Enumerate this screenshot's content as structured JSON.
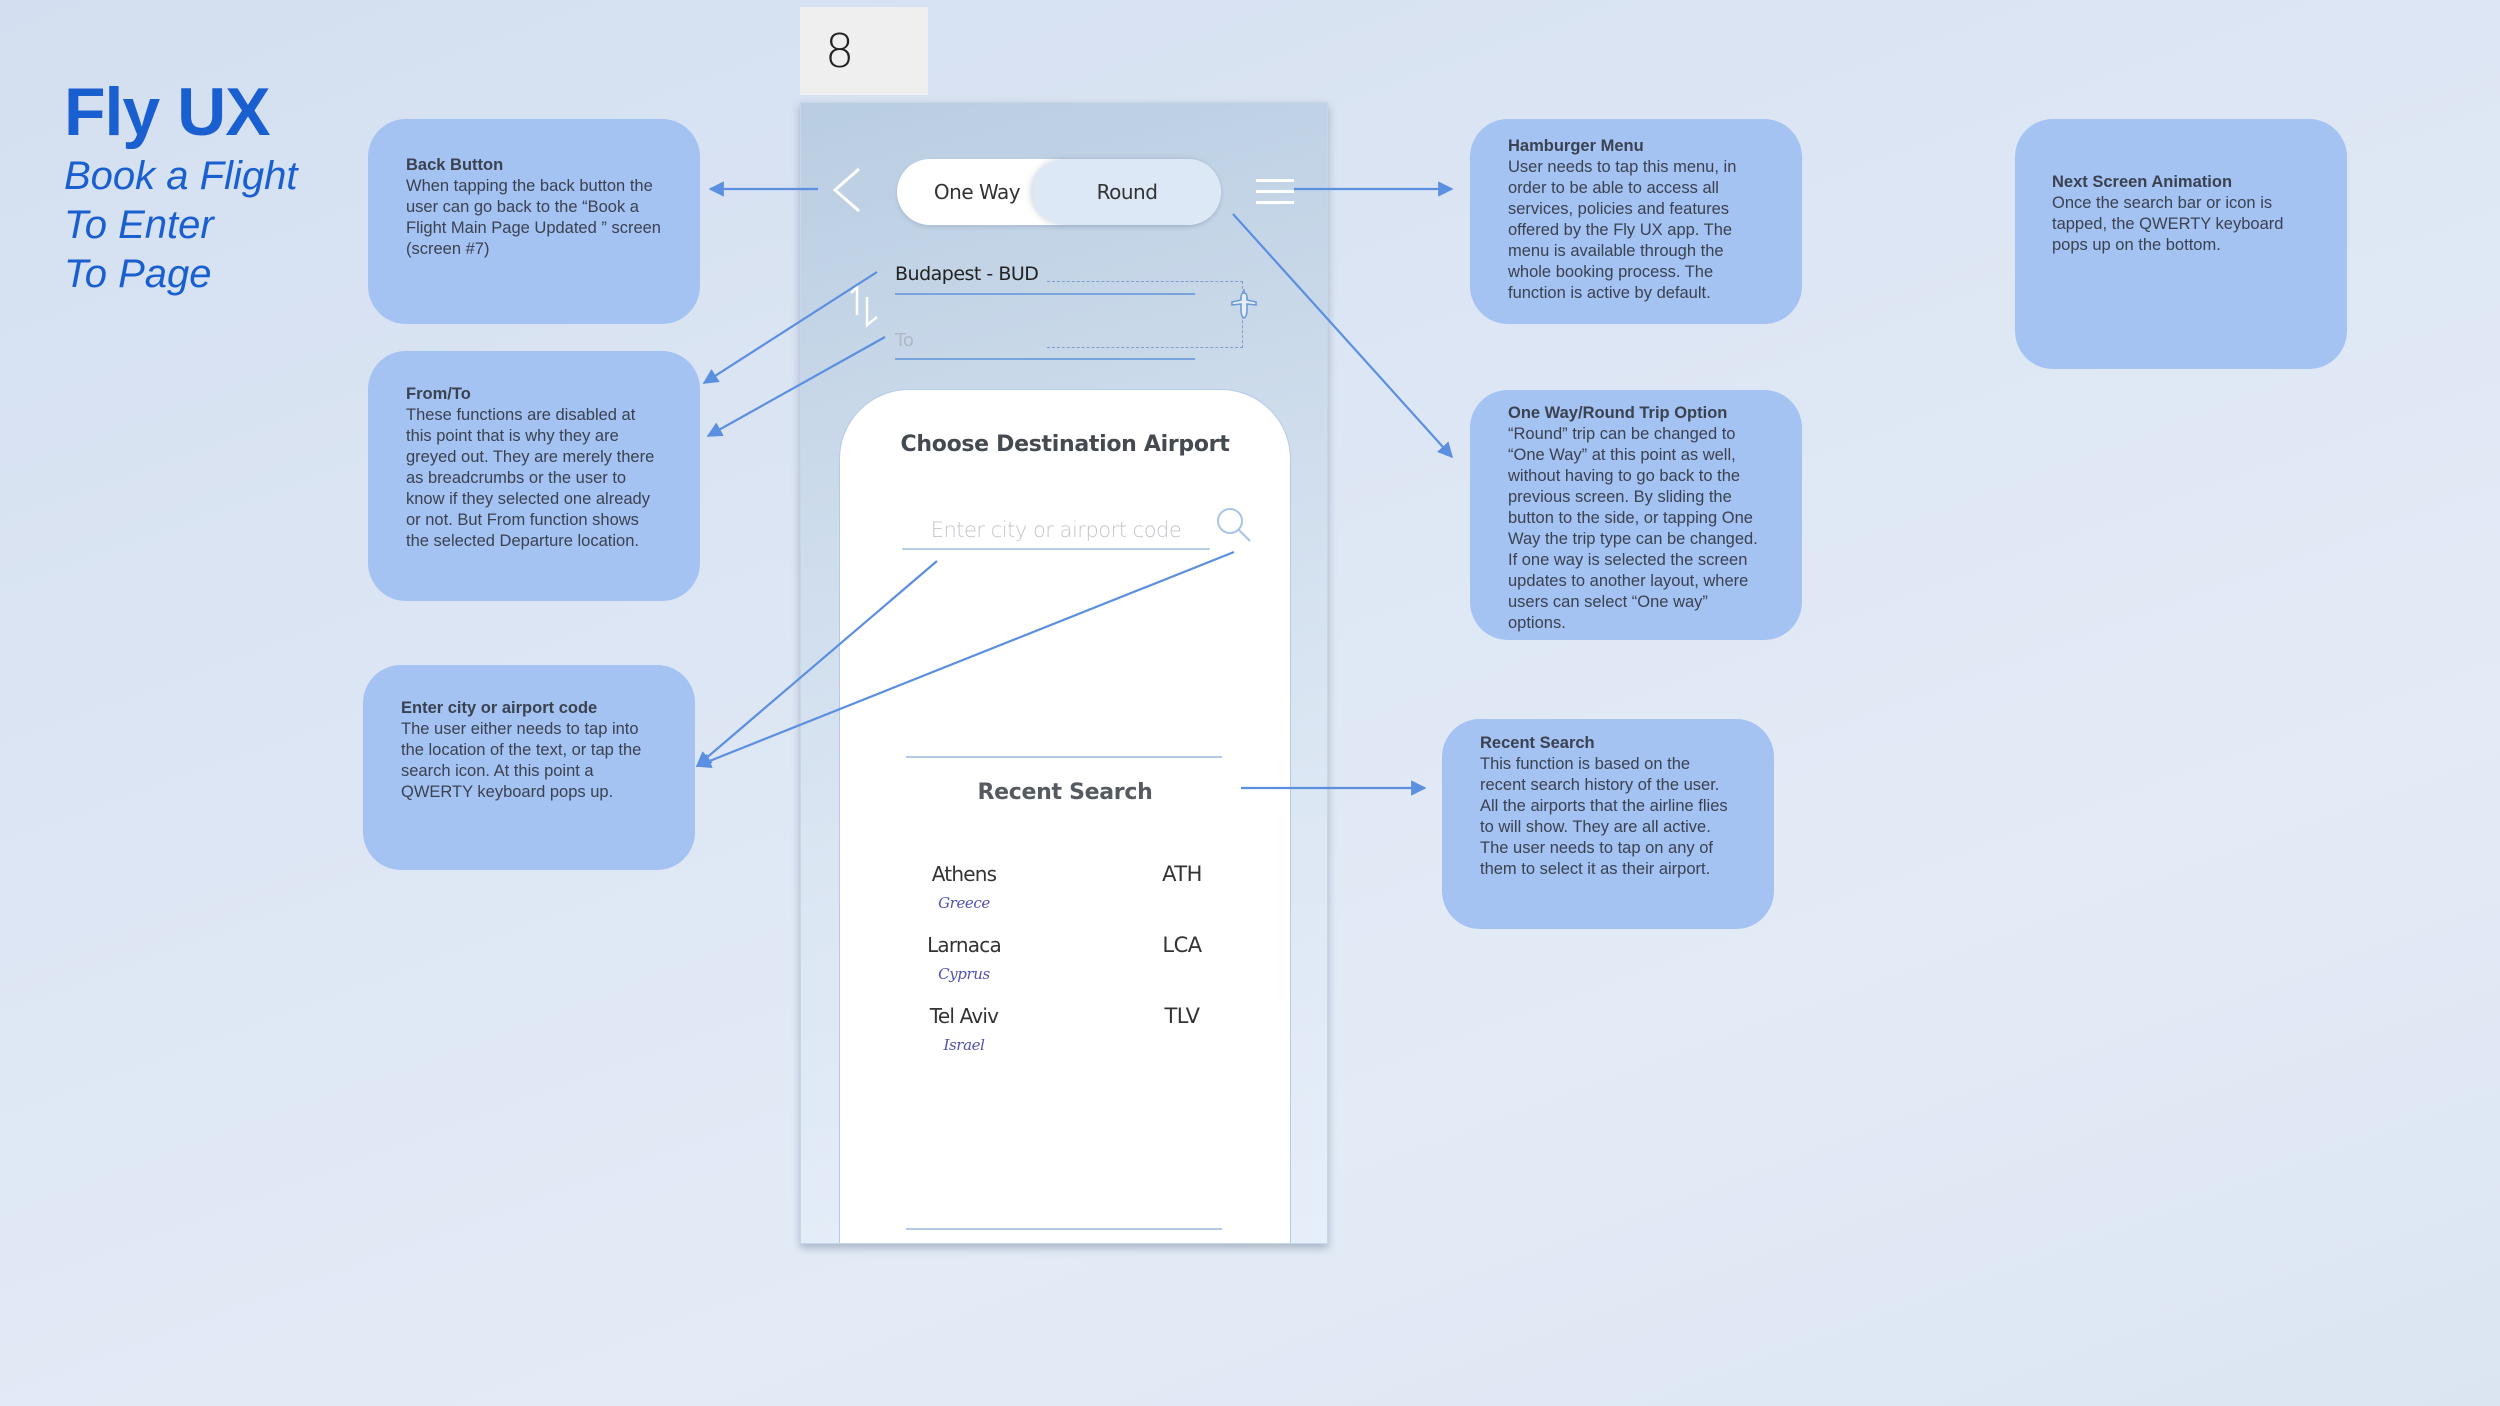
{
  "header": {
    "app_title": "Fly UX",
    "subtitle_lines": [
      "Book a Flight",
      "To Enter",
      "To Page"
    ]
  },
  "screen_number": "8",
  "phone": {
    "back_icon": "chevron-left-icon",
    "trip_toggle": {
      "options": [
        "One Way",
        "Round"
      ],
      "selected": "Round"
    },
    "menu_icon": "hamburger-menu-icon",
    "from_value": "Budapest - BUD",
    "to_placeholder": "To",
    "swap_icon": "swap-arrows-icon",
    "plane_icon": "airplane-icon",
    "card": {
      "title": "Choose Destination Airport",
      "search_placeholder": "Enter city or airport code",
      "search_value": "",
      "search_icon": "search-icon",
      "recent_title": "Recent Search",
      "recent_items": [
        {
          "city": "Athens",
          "country": "Greece",
          "code": "ATH"
        },
        {
          "city": "Larnaca",
          "country": "Cyprus",
          "code": "LCA"
        },
        {
          "city": "Tel Aviv",
          "country": "Israel",
          "code": "TLV"
        }
      ]
    }
  },
  "callouts": {
    "back_button": {
      "title": "Back Button",
      "body": "When tapping the back button the user can go back to the “Book a Flight Main Page Updated ” screen (screen #7)"
    },
    "from_to": {
      "title": "From/To",
      "body": "These functions are disabled at this point that is why they are greyed out. They are merely there as breadcrumbs or the user to know if they selected one already or not. But From function shows the selected Departure location."
    },
    "enter_city": {
      "title": "Enter city or airport code",
      "body": "The user either needs to tap into the location of the text, or tap the search icon. At this point a QWERTY keyboard pops up."
    },
    "hamburger_menu": {
      "title": "Hamburger Menu",
      "body": "User needs to tap this menu, in order to be able to access all services, policies and features offered by the Fly UX app. The menu is available through the whole booking process. The function is active by default."
    },
    "trip_option": {
      "title": "One Way/Round Trip Option",
      "body": "“Round” trip can be changed to “One Way” at this point as well, without having to go back to the previous screen. By sliding the button to the side, or tapping One Way the trip type can be changed. If one way is selected the screen updates to another layout, where users can select “One way” options."
    },
    "recent_search": {
      "title": "Recent Search",
      "body": "This function is based on the recent search history of the user. All the airports that the airline flies to will show. They are all active. The user needs to tap on any of them to select it as their airport."
    },
    "next_screen": {
      "title": "Next Screen Animation",
      "body": "Once the search bar or icon is tapped, the  QWERTY keyboard pops up on the bottom."
    }
  },
  "colors": {
    "brand_blue": "#1a5fd0",
    "callout_fill": "#a4c2f2",
    "connector": "#5b8fe0",
    "country_text": "#5052b4"
  }
}
